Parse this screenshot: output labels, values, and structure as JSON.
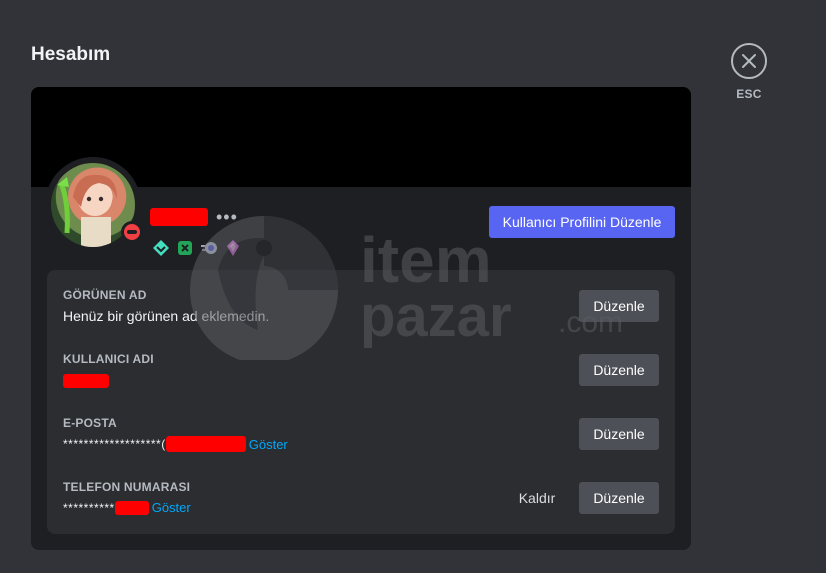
{
  "page": {
    "title": "Hesabım"
  },
  "esc": {
    "label": "ESC"
  },
  "profile": {
    "more_label": "•••",
    "edit_profile_label": "Kullanıcı Profilini Düzenle",
    "status": "dnd",
    "badges": [
      "hypesquad-badge",
      "nitro-badge",
      "boost-badge",
      "gem-badge"
    ]
  },
  "fields": {
    "display_name": {
      "label": "GÖRÜNEN AD",
      "value": "Henüz bir görünen ad eklemedin.",
      "edit_label": "Düzenle"
    },
    "username": {
      "label": "KULLANICI ADI",
      "edit_label": "Düzenle"
    },
    "email": {
      "label": "E-POSTA",
      "masked": "*******************(",
      "show_label": "Göster",
      "edit_label": "Düzenle"
    },
    "phone": {
      "label": "TELEFON NUMARASI",
      "masked": "**********",
      "show_label": "Göster",
      "remove_label": "Kaldır",
      "edit_label": "Düzenle"
    }
  },
  "watermark": {
    "line1": "item",
    "line2": "pazar",
    "line3": ".com"
  },
  "colors": {
    "accent": "#5865f2",
    "link": "#00a8fc",
    "dnd": "#f23f43",
    "redaction": "#ff0000"
  }
}
